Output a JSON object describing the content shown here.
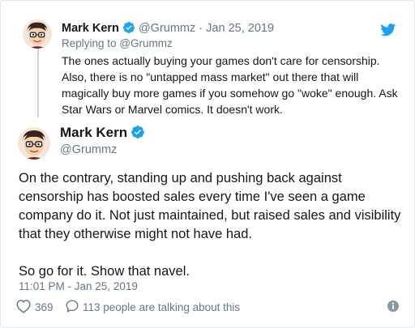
{
  "parent_tweet": {
    "author_name": "Mark Kern",
    "handle": "@Grummz",
    "separator": "·",
    "date": "Jan 25, 2019",
    "replying_to_label": "Replying to",
    "replying_to_handle": "@Grummz",
    "text": "The ones actually buying your games don't care for censorship. Also, there is no \"untapped mass market\" out there that will magically buy more games if you somehow go \"woke\" enough. Ask Star Wars or Marvel comics. It doesn't work."
  },
  "main_tweet": {
    "author_name": "Mark Kern",
    "handle": "@Grummz",
    "paragraph_1": "On the contrary, standing up and pushing back against censorship has boosted sales every time I've seen a game company do it. Not just maintained, but raised sales and visibility that they otherwise might not have had.",
    "paragraph_2": "So go for it. Show that navel.",
    "timestamp": "11:01 PM - Jan 25, 2019",
    "likes": "369",
    "talking": "113 people are talking about this"
  },
  "icons": {
    "verified": "verified-badge-icon",
    "bird": "twitter-bird-icon",
    "heart": "heart-icon",
    "comment": "comment-bubble-icon",
    "info": "info-icon"
  },
  "colors": {
    "twitter_blue": "#1da1f2",
    "text": "#14171a",
    "muted": "#657786",
    "border": "#e1e8ed",
    "thread_line": "#ccd6dd"
  }
}
